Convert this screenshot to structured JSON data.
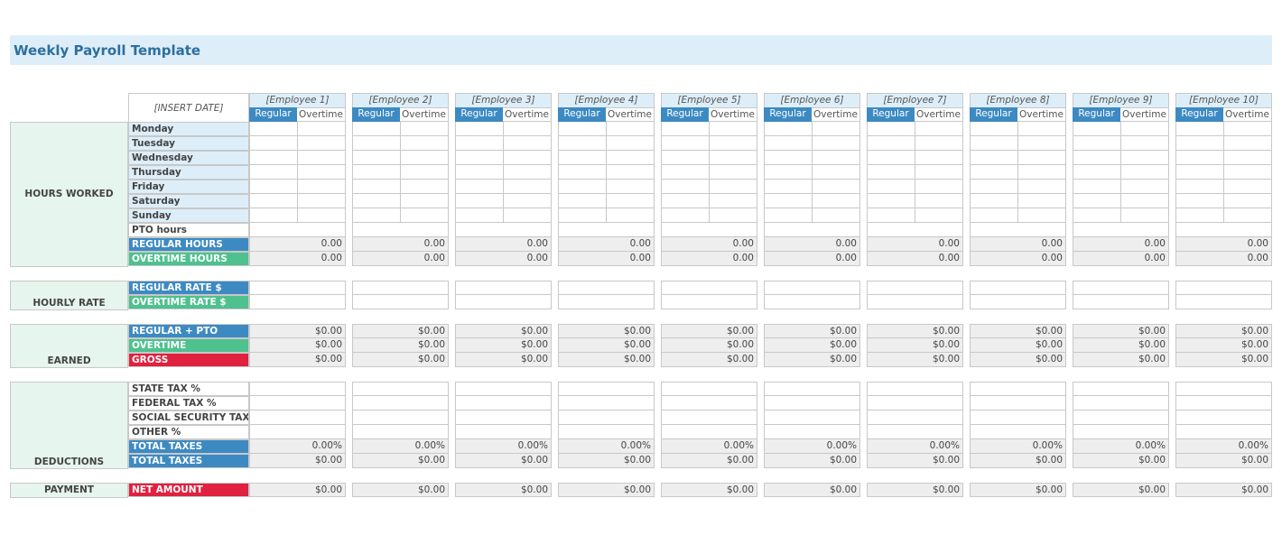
{
  "title": "Weekly Payroll Template",
  "date_placeholder": "[INSERT DATE]",
  "employees": [
    "[Employee 1]",
    "[Employee 2]",
    "[Employee 3]",
    "[Employee 4]",
    "[Employee 5]",
    "[Employee 6]",
    "[Employee 7]",
    "[Employee 8]",
    "[Employee 9]",
    "[Employee 10]"
  ],
  "subheaders": {
    "regular": "Regular",
    "overtime": "Overtime"
  },
  "sections": {
    "hours_worked": "HOURS WORKED",
    "hourly_rate": "HOURLY RATE",
    "earned": "EARNED",
    "deductions": "DEDUCTIONS",
    "payment": "PAYMENT"
  },
  "days": [
    "Monday",
    "Tuesday",
    "Wednesday",
    "Thursday",
    "Friday",
    "Saturday",
    "Sunday"
  ],
  "labels": {
    "pto_hours": "PTO hours",
    "regular_hours": "REGULAR HOURS",
    "overtime_hours": "OVERTIME HOURS",
    "regular_rate": "REGULAR RATE $",
    "overtime_rate": "OVERTIME RATE $",
    "regular_pto": "REGULAR + PTO",
    "overtime": "OVERTIME",
    "gross": "GROSS",
    "state_tax": "STATE TAX %",
    "federal_tax": "FEDERAL TAX %",
    "social_security_tax": "SOCIAL SECURITY TAX",
    "other": "OTHER %",
    "total_taxes_pct": "TOTAL TAXES",
    "total_taxes_amt": "TOTAL TAXES",
    "net_amount": "NET AMOUNT"
  },
  "values": {
    "hours": "0.00",
    "money": "$0.00",
    "percent": "0.00%"
  },
  "colors": {
    "title_bg": "#ddeef9",
    "title_text": "#2e6f9e",
    "blue": "#3d8ac3",
    "green": "#4ec18e",
    "red": "#e0213f",
    "section_bg": "#e6f5ee",
    "computed_bg": "#eeeeee"
  }
}
